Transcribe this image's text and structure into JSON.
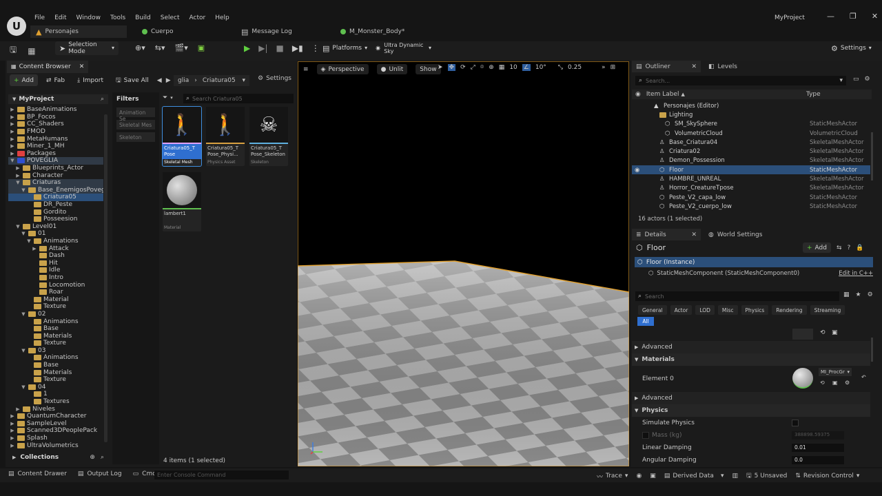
{
  "app": {
    "project_name": "MyProject",
    "menu": [
      "File",
      "Edit",
      "Window",
      "Tools",
      "Build",
      "Select",
      "Actor",
      "Help"
    ],
    "tabs": [
      {
        "label": "Personajes",
        "active": true
      },
      {
        "label": "Cuerpo",
        "active": false
      },
      {
        "label": "Message Log",
        "active": false
      },
      {
        "label": "M_Monster_Body*",
        "active": false
      }
    ]
  },
  "toolbar": {
    "selection_mode": "Selection Mode",
    "platforms": "Platforms",
    "sky": "Ultra Dynamic Sky",
    "settings": "Settings"
  },
  "content_browser": {
    "tab_label": "Content Browser",
    "add": "Add",
    "fab": "Fab",
    "import": "Import",
    "save_all": "Save All",
    "settings": "Settings",
    "path": [
      "glia",
      "Criatura05"
    ],
    "root": "MyProject",
    "filters_label": "Filters",
    "search_placeholder": "Search Criatura05",
    "filters": [
      "Animation Se",
      "Skeletal Mes",
      "Skeleton"
    ],
    "tree": [
      {
        "label": "BaseAnimations",
        "depth": 1,
        "arrow": "▶"
      },
      {
        "label": "BP_Focos",
        "depth": 1,
        "arrow": "▶"
      },
      {
        "label": "CC_Shaders",
        "depth": 1,
        "arrow": "▶"
      },
      {
        "label": "FMOD",
        "depth": 1,
        "arrow": "▶"
      },
      {
        "label": "MetaHumans",
        "depth": 1,
        "arrow": "▶"
      },
      {
        "label": "Miner_1_MH",
        "depth": 1,
        "arrow": "▶"
      },
      {
        "label": "Packages",
        "depth": 1,
        "arrow": "▶"
      },
      {
        "label": "POVEGLIA",
        "depth": 1,
        "arrow": "▼"
      },
      {
        "label": "Blueprints_Actor",
        "depth": 2,
        "arrow": "▶"
      },
      {
        "label": "Character",
        "depth": 2,
        "arrow": "▶"
      },
      {
        "label": "Criaturas",
        "depth": 2,
        "arrow": "▼"
      },
      {
        "label": "Base_EnemigosPoveglia",
        "depth": 3,
        "arrow": "▼"
      },
      {
        "label": "Criatura05",
        "depth": 4,
        "arrow": ""
      },
      {
        "label": "DR_Peste",
        "depth": 4,
        "arrow": ""
      },
      {
        "label": "Gordito",
        "depth": 4,
        "arrow": ""
      },
      {
        "label": "Posseesion",
        "depth": 4,
        "arrow": ""
      },
      {
        "label": "Level01",
        "depth": 2,
        "arrow": "▼"
      },
      {
        "label": "01",
        "depth": 3,
        "arrow": "▼"
      },
      {
        "label": "Animations",
        "depth": 4,
        "arrow": "▼"
      },
      {
        "label": "Attack",
        "depth": 5,
        "arrow": "▶"
      },
      {
        "label": "Dash",
        "depth": 5,
        "arrow": ""
      },
      {
        "label": "Hit",
        "depth": 5,
        "arrow": ""
      },
      {
        "label": "Idle",
        "depth": 5,
        "arrow": ""
      },
      {
        "label": "Intro",
        "depth": 5,
        "arrow": ""
      },
      {
        "label": "Locomotion",
        "depth": 5,
        "arrow": ""
      },
      {
        "label": "Roar",
        "depth": 5,
        "arrow": ""
      },
      {
        "label": "Material",
        "depth": 4,
        "arrow": ""
      },
      {
        "label": "Texture",
        "depth": 4,
        "arrow": ""
      },
      {
        "label": "02",
        "depth": 3,
        "arrow": "▼"
      },
      {
        "label": "Animations",
        "depth": 4,
        "arrow": ""
      },
      {
        "label": "Base",
        "depth": 4,
        "arrow": ""
      },
      {
        "label": "Materials",
        "depth": 4,
        "arrow": ""
      },
      {
        "label": "Texture",
        "depth": 4,
        "arrow": ""
      },
      {
        "label": "03",
        "depth": 3,
        "arrow": "▼"
      },
      {
        "label": "Animations",
        "depth": 4,
        "arrow": ""
      },
      {
        "label": "Base",
        "depth": 4,
        "arrow": ""
      },
      {
        "label": "Materials",
        "depth": 4,
        "arrow": ""
      },
      {
        "label": "Texture",
        "depth": 4,
        "arrow": ""
      },
      {
        "label": "04",
        "depth": 3,
        "arrow": "▼"
      },
      {
        "label": "1",
        "depth": 4,
        "arrow": ""
      },
      {
        "label": "Textures",
        "depth": 4,
        "arrow": ""
      },
      {
        "label": "Niveles",
        "depth": 2,
        "arrow": "▶"
      },
      {
        "label": "QuantumCharacter",
        "depth": 1,
        "arrow": "▶"
      },
      {
        "label": "SampleLevel",
        "depth": 1,
        "arrow": "▶"
      },
      {
        "label": "Scanned3DPeoplePack",
        "depth": 1,
        "arrow": "▶"
      },
      {
        "label": "Splash",
        "depth": 1,
        "arrow": "▶"
      },
      {
        "label": "UltraVolumetrics",
        "depth": 1,
        "arrow": "▶"
      }
    ],
    "collections": "Collections",
    "assets": [
      {
        "name": "Criatura05_T Pose",
        "type": "Skeletal Mesh",
        "color": "#e0a0ff",
        "selected": true
      },
      {
        "name": "Criatura05_T Pose_Physi...",
        "type": "Physics Asset",
        "color": "#d8a040",
        "selected": false
      },
      {
        "name": "Criatura05_T Pose_Skeleton",
        "type": "Skeleton",
        "color": "#5fb0e0",
        "selected": false
      },
      {
        "name": "lambert1",
        "type": "Material",
        "color": "#5fbf4f",
        "selected": false
      }
    ],
    "item_count": "4 items (1 selected)"
  },
  "viewport": {
    "perspective": "Perspective",
    "lit": "Unlit",
    "show": "Show",
    "grid_snap": "10",
    "rot_snap": "10°",
    "scale_snap": "0.25"
  },
  "outliner": {
    "tab": "Outliner",
    "levels_tab": "Levels",
    "search_placeholder": "Search...",
    "col_label": "Item Label",
    "col_type": "Type",
    "rows": [
      {
        "label": "Personajes (Editor)",
        "type": "",
        "indent": 2,
        "selected": false
      },
      {
        "label": "Lighting",
        "type": "",
        "indent": 3,
        "selected": false
      },
      {
        "label": "SM_SkySphere",
        "type": "StaticMeshActor",
        "indent": 4,
        "selected": false
      },
      {
        "label": "VolumetricCloud",
        "type": "VolumetricCloud",
        "indent": 4,
        "selected": false
      },
      {
        "label": "Base_Criatura04",
        "type": "SkeletalMeshActor",
        "indent": 3,
        "selected": false
      },
      {
        "label": "Criatura02",
        "type": "SkeletalMeshActor",
        "indent": 3,
        "selected": false
      },
      {
        "label": "Demon_Possession",
        "type": "SkeletalMeshActor",
        "indent": 3,
        "selected": false
      },
      {
        "label": "Floor",
        "type": "StaticMeshActor",
        "indent": 3,
        "selected": true
      },
      {
        "label": "HAMBRE_UNREAL",
        "type": "SkeletalMeshActor",
        "indent": 3,
        "selected": false
      },
      {
        "label": "Horror_CreatureTpose",
        "type": "SkeletalMeshActor",
        "indent": 3,
        "selected": false
      },
      {
        "label": "Peste_V2_capa_low",
        "type": "StaticMeshActor",
        "indent": 3,
        "selected": false
      },
      {
        "label": "Peste_V2_cuerpo_low",
        "type": "StaticMeshActor",
        "indent": 3,
        "selected": false
      }
    ],
    "actor_count": "16 actors (1 selected)"
  },
  "details": {
    "tab": "Details",
    "world_tab": "World Settings",
    "object_name": "Floor",
    "add": "Add",
    "instance": "Floor (Instance)",
    "component": "StaticMeshComponent (StaticMeshComponent0)",
    "edit_cpp": "Edit in C++",
    "search_placeholder": "Search",
    "categories": [
      "General",
      "Actor",
      "LOD",
      "Misc",
      "Physics",
      "Rendering",
      "Streaming"
    ],
    "all": "All",
    "advanced1": "Advanced",
    "materials_section": "Materials",
    "element0": "Element 0",
    "material_name": "MI_ProcGr",
    "advanced2": "Advanced",
    "physics_section": "Physics",
    "simulate_physics": "Simulate Physics",
    "mass_label": "Mass (kg)",
    "mass_value": "388898.59375",
    "linear_damping_label": "Linear Damping",
    "linear_damping_value": "0.01",
    "angular_damping_label": "Angular Damping",
    "angular_damping_value": "0.0"
  },
  "statusbar": {
    "content_drawer": "Content Drawer",
    "output_log": "Output Log",
    "cmd": "Cmd",
    "console_placeholder": "Enter Console Command",
    "trace": "Trace",
    "derived_data": "Derived Data",
    "unsaved": "5 Unsaved",
    "revision_control": "Revision Control"
  }
}
